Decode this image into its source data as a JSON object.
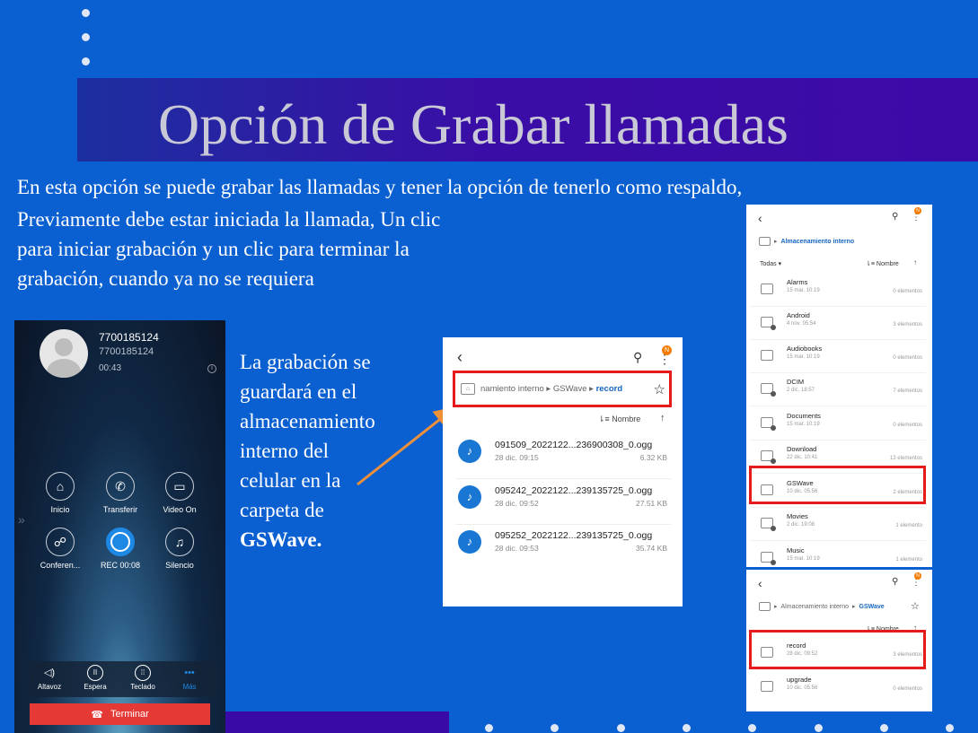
{
  "slide": {
    "title": "Opción de Grabar llamadas",
    "line1": "En esta opción se puede grabar las llamadas y tener la opción de tenerlo como respaldo,",
    "paragraph": "Previamente debe estar iniciada la llamada, Un clic para iniciar grabación y un clic para terminar la grabación, cuando ya no se requiera",
    "note_plain": "La grabación se guardará en el almacenamiento interno del celular en la carpeta de",
    "note_bold": "GSWave."
  },
  "call_screen": {
    "number": "7700185124",
    "number_sub": "7700185124",
    "duration": "00:43",
    "buttons": [
      {
        "label": "Inicio",
        "icon": "home-icon"
      },
      {
        "label": "Transferir",
        "icon": "transfer-icon"
      },
      {
        "label": "Video On",
        "icon": "video-icon"
      },
      {
        "label": "Conferen...",
        "icon": "conference-icon"
      },
      {
        "label": "REC 00:08",
        "icon": "record-icon"
      },
      {
        "label": "Silencio",
        "icon": "mute-icon"
      }
    ],
    "toolbar": [
      {
        "label": "Altavoz",
        "icon": "speaker-icon"
      },
      {
        "label": "Espera",
        "icon": "pause-icon"
      },
      {
        "label": "Teclado",
        "icon": "keypad-icon"
      },
      {
        "label": "Más",
        "icon": "more-icon"
      }
    ],
    "hangup_label": "Terminar",
    "colors": {
      "record_active": "#1e88e5",
      "hangup": "#e53935",
      "more_active": "#1e88e5"
    }
  },
  "file_manager": {
    "badge": "N",
    "breadcrumb": {
      "prefix": "namiento interno",
      "folder": "GSWave",
      "current": "record"
    },
    "sort_label": "Nombre",
    "files": [
      {
        "name": "091509_2022122...236900308_0.ogg",
        "date": "28 dic. 09:15",
        "size": "6.32 KB"
      },
      {
        "name": "095242_2022122...239135725_0.ogg",
        "date": "28 dic. 09:52",
        "size": "27.51 KB"
      },
      {
        "name": "095252_2022122...239135725_0.ogg",
        "date": "28 dic. 09:53",
        "size": "35.74 KB"
      }
    ]
  },
  "storage_panel": {
    "breadcrumb": "Almacenamiento interno",
    "filter": "Todas",
    "sort_label": "Nombre",
    "badge": "N",
    "folders": [
      {
        "name": "Alarms",
        "date": "15 mar. 10:19",
        "count": "0 elementos"
      },
      {
        "name": "Android",
        "date": "4 nov. 05:54",
        "count": "3 elementos"
      },
      {
        "name": "Audiobooks",
        "date": "15 mar. 10:19",
        "count": "0 elementos"
      },
      {
        "name": "DCIM",
        "date": "2 dic. 18:57",
        "count": "7 elementos"
      },
      {
        "name": "Documents",
        "date": "15 mar. 10:19",
        "count": "0 elementos"
      },
      {
        "name": "Download",
        "date": "22 dic. 10:41",
        "count": "13 elementos"
      },
      {
        "name": "GSWave",
        "date": "10 dic. 05:56",
        "count": "2 elementos"
      },
      {
        "name": "Movies",
        "date": "2 dic. 19:08",
        "count": "1 elemento"
      },
      {
        "name": "Music",
        "date": "15 mar. 10:19",
        "count": "1 elemento"
      }
    ]
  },
  "gswave_panel": {
    "breadcrumb_prefix": "Almacenamiento interno",
    "breadcrumb_current": "GSWave",
    "sort_label": "Nombre",
    "badge": "N",
    "folders": [
      {
        "name": "record",
        "date": "28 dic. 09:52",
        "count": "3 elementos"
      },
      {
        "name": "upgrade",
        "date": "10 dic. 05:56",
        "count": "0 elementos"
      }
    ]
  },
  "colors": {
    "background": "#0a5fd1",
    "title_band": "#3d0aa8",
    "title_text": "#c8c8d6",
    "highlight_box": "#e51b1b",
    "arrow": "#f0913a"
  }
}
